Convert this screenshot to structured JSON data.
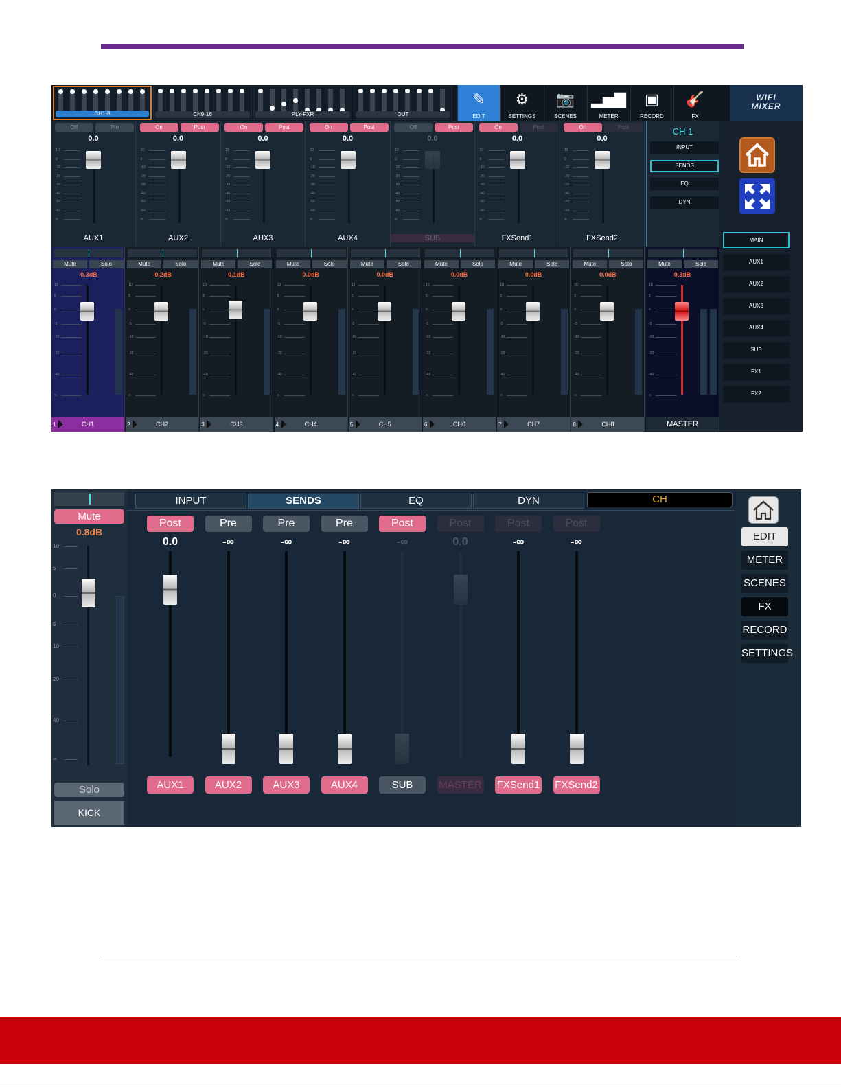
{
  "screen1": {
    "banks": [
      {
        "label": "CH1-8",
        "selected": true
      },
      {
        "label": "CH9-16",
        "selected": false
      },
      {
        "label": "PLY-FXR",
        "selected": false
      },
      {
        "label": "OUT",
        "selected": false
      }
    ],
    "toolbar": [
      {
        "label": "EDIT",
        "icon": "edit-icon",
        "active": true
      },
      {
        "label": "SETTINGS",
        "icon": "gear-icon",
        "active": false
      },
      {
        "label": "SCENES",
        "icon": "camera-icon",
        "active": false
      },
      {
        "label": "METER",
        "icon": "bar-chart-icon",
        "active": false
      },
      {
        "label": "RECORD",
        "icon": "cassette-icon",
        "active": false
      },
      {
        "label": "FX",
        "icon": "guitar-icon",
        "active": false
      }
    ],
    "logo": {
      "line1": "WIFI",
      "line2": "MIXER"
    },
    "sends": [
      {
        "name": "AUX1",
        "on": "Off",
        "tap": "Pre",
        "value": "0.0",
        "state": "gray",
        "dim": false
      },
      {
        "name": "AUX2",
        "on": "On",
        "tap": "Post",
        "value": "0.0",
        "state": "pink",
        "dim": false
      },
      {
        "name": "AUX3",
        "on": "On",
        "tap": "Post",
        "value": "0.0",
        "state": "pink",
        "dim": false
      },
      {
        "name": "AUX4",
        "on": "On",
        "tap": "Post",
        "value": "0.0",
        "state": "pink",
        "dim": false
      },
      {
        "name": "SUB",
        "on": "Off",
        "tap": "Post",
        "value": "0.0",
        "state": "gray",
        "dim": true
      },
      {
        "name": "FXSend1",
        "on": "On",
        "tap": "Post",
        "value": "0.0",
        "state": "pink",
        "dim": false
      },
      {
        "name": "FXSend2",
        "on": "On",
        "tap": "Post",
        "value": "0.0",
        "state": "pink",
        "dim": false
      }
    ],
    "send_scale": [
      "10",
      "0",
      "-10",
      "-20",
      "-30",
      "-40",
      "-50",
      "-60",
      "∞"
    ],
    "ch_panel": {
      "title": "CH 1",
      "buttons": [
        {
          "label": "INPUT",
          "selected": false
        },
        {
          "label": "SENDS",
          "selected": true
        },
        {
          "label": "EQ",
          "selected": false
        },
        {
          "label": "DYN",
          "selected": false
        }
      ]
    },
    "right_panel": {
      "home_icon": "home-icon",
      "expand_icon": "expand-icon",
      "buttons": [
        {
          "label": "MAIN",
          "selected": true
        },
        {
          "label": "AUX1",
          "selected": false
        },
        {
          "label": "AUX2",
          "selected": false
        },
        {
          "label": "AUX3",
          "selected": false
        },
        {
          "label": "AUX4",
          "selected": false
        },
        {
          "label": "SUB",
          "selected": false
        },
        {
          "label": "FX1",
          "selected": false
        },
        {
          "label": "FX2",
          "selected": false
        }
      ]
    },
    "channels": [
      {
        "num": "1",
        "name": "CH1",
        "db": "-0.3dB"
      },
      {
        "num": "2",
        "name": "CH2",
        "db": "-0.2dB"
      },
      {
        "num": "3",
        "name": "CH3",
        "db": "0.1dB"
      },
      {
        "num": "4",
        "name": "CH4",
        "db": "0.0dB"
      },
      {
        "num": "5",
        "name": "CH5",
        "db": "0.0dB"
      },
      {
        "num": "6",
        "name": "CH6",
        "db": "0.0dB"
      },
      {
        "num": "7",
        "name": "CH7",
        "db": "0.0dB"
      },
      {
        "num": "8",
        "name": "CH8",
        "db": "0.0dB"
      }
    ],
    "master": {
      "name": "MASTER",
      "db": "0.3dB"
    },
    "channel_buttons": {
      "mute": "Mute",
      "solo": "Solo"
    },
    "fader_scale": [
      "10",
      "5",
      "0",
      "-5",
      "-10",
      "-20",
      "-40",
      "∞"
    ]
  },
  "screen2": {
    "left_strip": {
      "mute": "Mute",
      "db": "0.8dB",
      "solo": "Solo",
      "name": "KICK",
      "scale": [
        "10",
        "5",
        "0",
        "5",
        "10",
        "20",
        "40",
        "∞"
      ]
    },
    "tabs": [
      {
        "label": "INPUT",
        "selected": false
      },
      {
        "label": "SENDS",
        "selected": true
      },
      {
        "label": "EQ",
        "selected": false
      },
      {
        "label": "DYN",
        "selected": false
      }
    ],
    "ch_tab": "CH",
    "sends": [
      {
        "tap": "Post",
        "value": "0.0",
        "name": "AUX1",
        "style": "pink",
        "name_style": "pink",
        "level": 0.85,
        "dim": false
      },
      {
        "tap": "Pre",
        "value": "-∞",
        "name": "AUX2",
        "style": "gray",
        "name_style": "pink",
        "level": 0.0,
        "dim": false
      },
      {
        "tap": "Pre",
        "value": "-∞",
        "name": "AUX3",
        "style": "gray",
        "name_style": "pink",
        "level": 0.0,
        "dim": false
      },
      {
        "tap": "Pre",
        "value": "-∞",
        "name": "AUX4",
        "style": "gray",
        "name_style": "pink",
        "level": 0.0,
        "dim": false
      },
      {
        "tap": "Post",
        "value": "-∞",
        "name": "SUB",
        "style": "pink",
        "name_style": "gray",
        "level": 0.0,
        "dim": true
      },
      {
        "tap": "Post",
        "value": "0.0",
        "name": "MASTER",
        "style": "dim",
        "name_style": "dim",
        "level": 0.85,
        "dim": true
      },
      {
        "tap": "Post",
        "value": "-∞",
        "name": "FXSend1",
        "style": "dim",
        "name_style": "pink",
        "level": 0.0,
        "dim": false
      },
      {
        "tap": "Post",
        "value": "-∞",
        "name": "FXSend2",
        "style": "dim",
        "name_style": "pink",
        "level": 0.0,
        "dim": false
      }
    ],
    "side_buttons": [
      {
        "label": "EDIT",
        "style": "sel"
      },
      {
        "label": "METER",
        "style": "normal"
      },
      {
        "label": "SCENES",
        "style": "normal"
      },
      {
        "label": "FX",
        "style": "dark"
      },
      {
        "label": "RECORD",
        "style": "normal"
      },
      {
        "label": "SETTINGS",
        "style": "normal"
      }
    ],
    "home_icon": "home-icon"
  },
  "colors": {
    "purple_rule": "#6a2c91",
    "footer_band": "#c8000a",
    "accent_pink": "#e06b8b",
    "accent_cyan": "#4ee0e8"
  }
}
